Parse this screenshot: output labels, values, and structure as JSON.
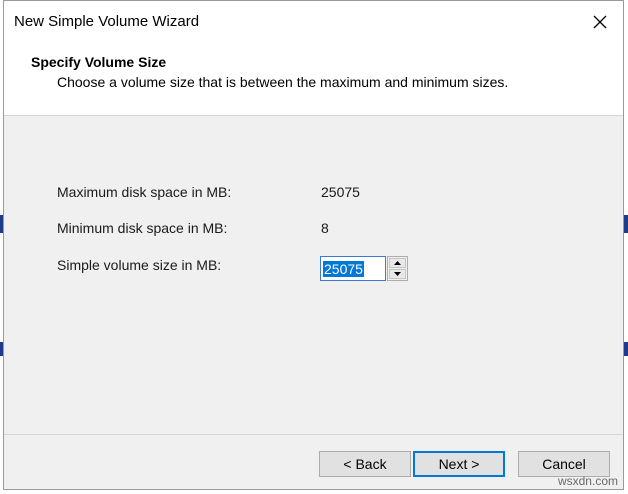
{
  "window": {
    "title": "New Simple Volume Wizard"
  },
  "header": {
    "title": "Specify Volume Size",
    "subtitle": "Choose a volume size that is between the maximum and minimum sizes."
  },
  "fields": {
    "max_label": "Maximum disk space in MB:",
    "max_value": "25075",
    "min_label": "Minimum disk space in MB:",
    "min_value": "8",
    "size_label": "Simple volume size in MB:",
    "size_value": "25075"
  },
  "buttons": {
    "back": "< Back",
    "next": "Next >",
    "cancel": "Cancel"
  },
  "watermark": "wsxdn.com",
  "colors": {
    "accent": "#0078d7",
    "dialog_bg": "#f0f0f0",
    "header_bg": "#ffffff"
  },
  "icons": {
    "close": "close-icon",
    "spin_up": "triangle-up-icon",
    "spin_down": "triangle-down-icon"
  }
}
